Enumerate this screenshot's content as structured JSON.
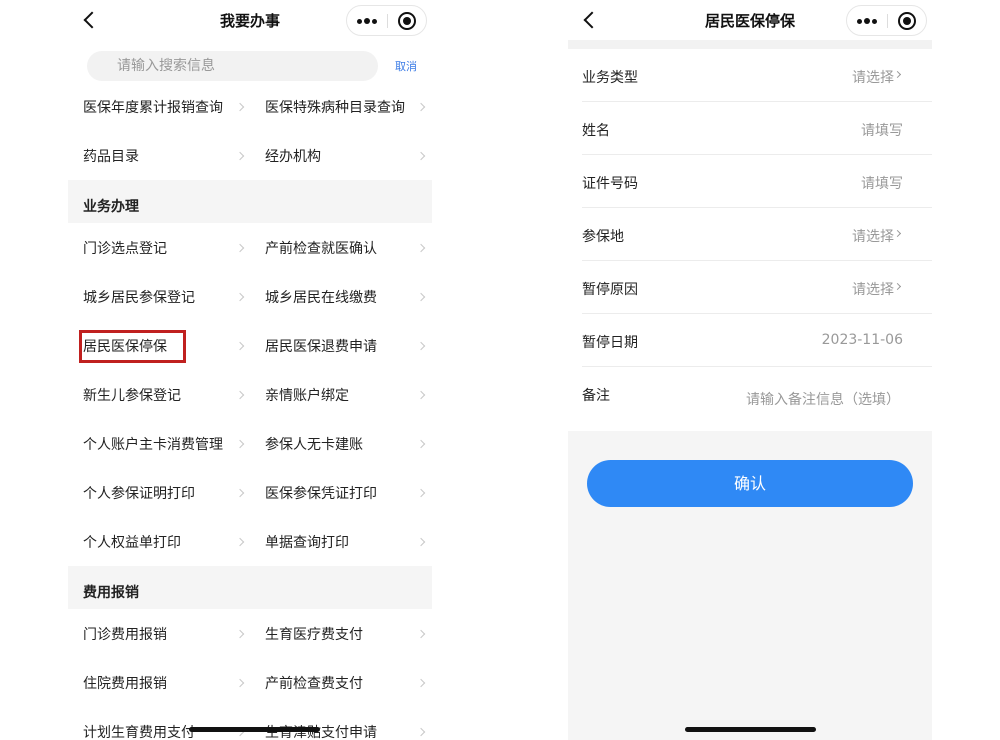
{
  "left": {
    "title": "我要办事",
    "search": {
      "placeholder": "请输入搜索信息",
      "cancel": "取消"
    },
    "rows_top": [
      [
        "医保年度累计报销查询",
        "医保特殊病种目录查询"
      ],
      [
        "药品目录",
        "经办机构"
      ]
    ],
    "section_business": {
      "title": "业务办理",
      "rows": [
        [
          "门诊选点登记",
          "产前检查就医确认"
        ],
        [
          "城乡居民参保登记",
          "城乡居民在线缴费"
        ],
        [
          "居民医保停保",
          "居民医保退费申请"
        ],
        [
          "新生儿参保登记",
          "亲情账户绑定"
        ],
        [
          "个人账户主卡消费管理",
          "参保人无卡建账"
        ],
        [
          "个人参保证明打印",
          "医保参保凭证打印"
        ],
        [
          "个人权益单打印",
          "单据查询打印"
        ]
      ]
    },
    "section_expense": {
      "title": "费用报销",
      "rows": [
        [
          "门诊费用报销",
          "生育医疗费支付"
        ],
        [
          "住院费用报销",
          "产前检查费支付"
        ],
        [
          "计划生育费用支付",
          "生育津贴支付申请"
        ]
      ]
    }
  },
  "right": {
    "title": "居民医保停保",
    "fields": [
      {
        "label": "业务类型",
        "value": "请选择",
        "type": "select"
      },
      {
        "label": "姓名",
        "value": "请填写",
        "type": "input"
      },
      {
        "label": "证件号码",
        "value": "请填写",
        "type": "input"
      },
      {
        "label": "参保地",
        "value": "请选择",
        "type": "select"
      },
      {
        "label": "暂停原因",
        "value": "请选择",
        "type": "select"
      },
      {
        "label": "暂停日期",
        "value": "2023-11-06",
        "type": "date"
      },
      {
        "label": "备注",
        "value": "请输入备注信息（选填）",
        "type": "textarea"
      }
    ],
    "confirm": "确认"
  },
  "colors": {
    "accent_blue": "#2f89f5",
    "highlight_red": "#c0201f",
    "link_blue": "#3a7be6"
  },
  "icons": [
    "back-chevron-icon",
    "more-dots-icon",
    "close-target-icon",
    "search-icon",
    "chevron-right-icon"
  ]
}
